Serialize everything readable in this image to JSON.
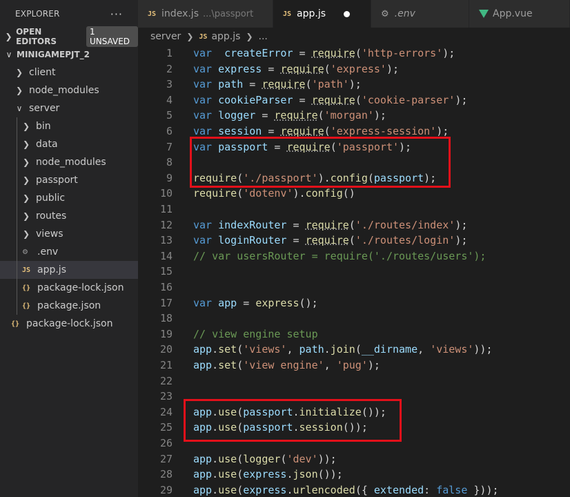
{
  "explorer": {
    "title": "EXPLORER",
    "more": "···",
    "open_editors": "OPEN EDITORS",
    "unsaved_badge": "1 UNSAVED",
    "project": "MINIGAMEPJT_2",
    "tree": [
      {
        "label": "client",
        "depth": 0,
        "kind": "folder-collapsed"
      },
      {
        "label": "node_modules",
        "depth": 0,
        "kind": "folder-collapsed"
      },
      {
        "label": "server",
        "depth": 0,
        "kind": "folder-expanded"
      },
      {
        "label": "bin",
        "depth": 1,
        "kind": "folder-collapsed"
      },
      {
        "label": "data",
        "depth": 1,
        "kind": "folder-collapsed"
      },
      {
        "label": "node_modules",
        "depth": 1,
        "kind": "folder-collapsed"
      },
      {
        "label": "passport",
        "depth": 1,
        "kind": "folder-collapsed"
      },
      {
        "label": "public",
        "depth": 1,
        "kind": "folder-collapsed"
      },
      {
        "label": "routes",
        "depth": 1,
        "kind": "folder-collapsed"
      },
      {
        "label": "views",
        "depth": 1,
        "kind": "folder-collapsed"
      },
      {
        "label": ".env",
        "depth": 1,
        "kind": "env-file"
      },
      {
        "label": "app.js",
        "depth": 1,
        "kind": "js-file",
        "selected": true
      },
      {
        "label": "package-lock.json",
        "depth": 1,
        "kind": "json-file"
      },
      {
        "label": "package.json",
        "depth": 1,
        "kind": "json-file"
      },
      {
        "label": "package-lock.json",
        "depth": 0,
        "kind": "json-file"
      }
    ]
  },
  "tabs": [
    {
      "icon": "JS",
      "label": "index.js",
      "hint": "...\\passport",
      "active": false
    },
    {
      "icon": "JS",
      "label": "app.js",
      "active": true,
      "unsaved": true
    },
    {
      "icon": "⚙",
      "label": ".env",
      "active": false
    },
    {
      "icon": "vue",
      "label": "App.vue",
      "active": false
    }
  ],
  "breadcrumb": {
    "folder": "server",
    "icon": "JS",
    "file": "app.js",
    "tail": "..."
  },
  "code": [
    {
      "n": "1",
      "t": [
        [
          "kw",
          "var"
        ],
        [
          "",
          "  "
        ],
        [
          "var",
          "createError"
        ],
        [
          "",
          " = "
        ],
        [
          "fnr",
          "require"
        ],
        [
          "",
          "("
        ],
        [
          "str",
          "'http-errors'"
        ],
        [
          "",
          ");"
        ]
      ]
    },
    {
      "n": "2",
      "t": [
        [
          "kw",
          "var"
        ],
        [
          "",
          " "
        ],
        [
          "var",
          "express"
        ],
        [
          "",
          " = "
        ],
        [
          "fnr",
          "require"
        ],
        [
          "",
          "("
        ],
        [
          "str",
          "'express'"
        ],
        [
          "",
          ");"
        ]
      ]
    },
    {
      "n": "3",
      "t": [
        [
          "kw",
          "var"
        ],
        [
          "",
          " "
        ],
        [
          "var",
          "path"
        ],
        [
          "",
          " = "
        ],
        [
          "fnr",
          "require"
        ],
        [
          "",
          "("
        ],
        [
          "str",
          "'path'"
        ],
        [
          "",
          ");"
        ]
      ]
    },
    {
      "n": "4",
      "t": [
        [
          "kw",
          "var"
        ],
        [
          "",
          " "
        ],
        [
          "var",
          "cookieParser"
        ],
        [
          "",
          " = "
        ],
        [
          "fnr",
          "require"
        ],
        [
          "",
          "("
        ],
        [
          "str",
          "'cookie-parser'"
        ],
        [
          "",
          ");"
        ]
      ]
    },
    {
      "n": "5",
      "t": [
        [
          "kw",
          "var"
        ],
        [
          "",
          " "
        ],
        [
          "var",
          "logger"
        ],
        [
          "",
          " = "
        ],
        [
          "fnr",
          "require"
        ],
        [
          "",
          "("
        ],
        [
          "str",
          "'morgan'"
        ],
        [
          "",
          ");"
        ]
      ]
    },
    {
      "n": "6",
      "t": [
        [
          "kw",
          "var"
        ],
        [
          "",
          " "
        ],
        [
          "var",
          "session"
        ],
        [
          "",
          " = "
        ],
        [
          "fnr",
          "require"
        ],
        [
          "",
          "("
        ],
        [
          "str",
          "'express-session'"
        ],
        [
          "",
          ");"
        ]
      ]
    },
    {
      "n": "7",
      "t": [
        [
          "kw",
          "var"
        ],
        [
          "",
          " "
        ],
        [
          "var",
          "passport"
        ],
        [
          "",
          " = "
        ],
        [
          "fnr",
          "require"
        ],
        [
          "",
          "("
        ],
        [
          "str",
          "'passport'"
        ],
        [
          "",
          ");"
        ]
      ]
    },
    {
      "n": "8",
      "t": []
    },
    {
      "n": "9",
      "t": [
        [
          "fn",
          "require"
        ],
        [
          "",
          "("
        ],
        [
          "str",
          "'./passport'"
        ],
        [
          "",
          ")."
        ],
        [
          "fn",
          "config"
        ],
        [
          "",
          "("
        ],
        [
          "var",
          "passport"
        ],
        [
          "",
          ");"
        ]
      ]
    },
    {
      "n": "10",
      "t": [
        [
          "fn",
          "require"
        ],
        [
          "",
          "("
        ],
        [
          "str",
          "'dotenv'"
        ],
        [
          "",
          ")."
        ],
        [
          "fn",
          "config"
        ],
        [
          "",
          "()"
        ]
      ]
    },
    {
      "n": "11",
      "t": []
    },
    {
      "n": "12",
      "t": [
        [
          "kw",
          "var"
        ],
        [
          "",
          " "
        ],
        [
          "var",
          "indexRouter"
        ],
        [
          "",
          " = "
        ],
        [
          "fnr",
          "require"
        ],
        [
          "",
          "("
        ],
        [
          "str",
          "'./routes/index'"
        ],
        [
          "",
          ");"
        ]
      ]
    },
    {
      "n": "13",
      "t": [
        [
          "kw",
          "var"
        ],
        [
          "",
          " "
        ],
        [
          "var",
          "loginRouter"
        ],
        [
          "",
          " = "
        ],
        [
          "fnr",
          "require"
        ],
        [
          "",
          "("
        ],
        [
          "str",
          "'./routes/login'"
        ],
        [
          "",
          ");"
        ]
      ]
    },
    {
      "n": "14",
      "t": [
        [
          "cm",
          "// var usersRouter = require('./routes/users');"
        ]
      ]
    },
    {
      "n": "15",
      "t": []
    },
    {
      "n": "16",
      "t": []
    },
    {
      "n": "17",
      "t": [
        [
          "kw",
          "var"
        ],
        [
          "",
          " "
        ],
        [
          "var",
          "app"
        ],
        [
          "",
          " = "
        ],
        [
          "fn",
          "express"
        ],
        [
          "",
          "();"
        ]
      ]
    },
    {
      "n": "18",
      "t": []
    },
    {
      "n": "19",
      "t": [
        [
          "cm",
          "// view engine setup"
        ]
      ]
    },
    {
      "n": "20",
      "t": [
        [
          "var",
          "app"
        ],
        [
          "",
          "."
        ],
        [
          "fn",
          "set"
        ],
        [
          "",
          "("
        ],
        [
          "str",
          "'views'"
        ],
        [
          "",
          ", "
        ],
        [
          "var",
          "path"
        ],
        [
          "",
          "."
        ],
        [
          "fn",
          "join"
        ],
        [
          "",
          "("
        ],
        [
          "var",
          "__dirname"
        ],
        [
          "",
          ", "
        ],
        [
          "str",
          "'views'"
        ],
        [
          "",
          "));"
        ]
      ]
    },
    {
      "n": "21",
      "t": [
        [
          "var",
          "app"
        ],
        [
          "",
          "."
        ],
        [
          "fn",
          "set"
        ],
        [
          "",
          "("
        ],
        [
          "str",
          "'view engine'"
        ],
        [
          "",
          ", "
        ],
        [
          "str",
          "'pug'"
        ],
        [
          "",
          ");"
        ]
      ]
    },
    {
      "n": "22",
      "t": []
    },
    {
      "n": "23",
      "t": []
    },
    {
      "n": "24",
      "t": [
        [
          "var",
          "app"
        ],
        [
          "",
          "."
        ],
        [
          "fn",
          "use"
        ],
        [
          "",
          "("
        ],
        [
          "var",
          "passport"
        ],
        [
          "",
          "."
        ],
        [
          "fn",
          "initialize"
        ],
        [
          "",
          "());"
        ]
      ]
    },
    {
      "n": "25",
      "t": [
        [
          "var",
          "app"
        ],
        [
          "",
          "."
        ],
        [
          "fn",
          "use"
        ],
        [
          "",
          "("
        ],
        [
          "var",
          "passport"
        ],
        [
          "",
          "."
        ],
        [
          "fn",
          "session"
        ],
        [
          "",
          "());"
        ]
      ]
    },
    {
      "n": "26",
      "t": []
    },
    {
      "n": "27",
      "t": [
        [
          "var",
          "app"
        ],
        [
          "",
          "."
        ],
        [
          "fn",
          "use"
        ],
        [
          "",
          "("
        ],
        [
          "fn",
          "logger"
        ],
        [
          "",
          "("
        ],
        [
          "str",
          "'dev'"
        ],
        [
          "",
          "));"
        ]
      ]
    },
    {
      "n": "28",
      "t": [
        [
          "var",
          "app"
        ],
        [
          "",
          "."
        ],
        [
          "fn",
          "use"
        ],
        [
          "",
          "("
        ],
        [
          "var",
          "express"
        ],
        [
          "",
          "."
        ],
        [
          "fn",
          "json"
        ],
        [
          "",
          "());"
        ]
      ]
    },
    {
      "n": "29",
      "t": [
        [
          "var",
          "app"
        ],
        [
          "",
          "."
        ],
        [
          "fn",
          "use"
        ],
        [
          "",
          "("
        ],
        [
          "var",
          "express"
        ],
        [
          "",
          "."
        ],
        [
          "fn",
          "urlencoded"
        ],
        [
          "",
          "({ "
        ],
        [
          "var",
          "extended"
        ],
        [
          "",
          ": "
        ],
        [
          "kw",
          "false"
        ],
        [
          "",
          " }));"
        ]
      ]
    }
  ],
  "colors": {
    "highlight_box": "#e3101a",
    "keyword": "#569cd6",
    "string": "#ce9178",
    "function": "#dcdcaa",
    "variable": "#9cdcfe",
    "comment": "#6a9955"
  }
}
